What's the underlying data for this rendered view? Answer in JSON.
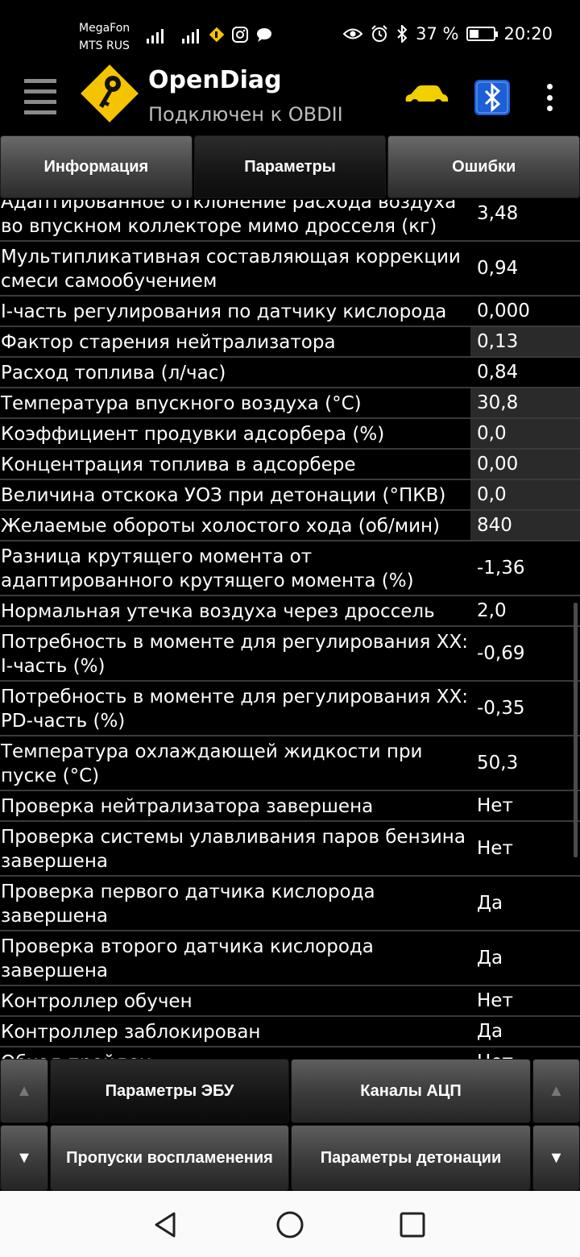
{
  "status_bar": {
    "carrier1": "MegaFon",
    "carrier2": "MTS RUS",
    "battery_text": "37 %",
    "battery_level": 0.37,
    "time": "20:20",
    "icons": [
      "signal-icon",
      "h-plus-icon",
      "signal-icon",
      "app-notification-icon",
      "instagram-icon",
      "chat-icon",
      "eye-icon",
      "alarm-icon",
      "bluetooth-icon",
      "battery-icon"
    ]
  },
  "app_bar": {
    "title": "OpenDiag",
    "subtitle": "Подключен к OBDII"
  },
  "tabs": [
    {
      "label": "Информация",
      "active": false
    },
    {
      "label": "Параметры",
      "active": true
    },
    {
      "label": "Ошибки",
      "active": false
    }
  ],
  "params": {
    "rows": [
      {
        "name": "Адаптированное отклонение расхода воздуха во впускном коллекторе мимо дросселя (кг)",
        "value": "3,48"
      },
      {
        "name": "Мультипликативная составляющая коррекции смеси самообучением",
        "value": "0,94"
      },
      {
        "name": "I-часть регулирования по датчику кислорода",
        "value": "0,000"
      },
      {
        "name": "Фактор старения нейтрализатора",
        "value": "0,13",
        "highlight": true
      },
      {
        "name": "Расход топлива (л/час)",
        "value": "0,84"
      },
      {
        "name": "Температура впускного воздуха (°C)",
        "value": "30,8",
        "highlight": true
      },
      {
        "name": "Коэффициент продувки адсорбера (%)",
        "value": "0,0",
        "highlight": true
      },
      {
        "name": "Концентрация топлива в адсорбере",
        "value": "0,00",
        "highlight": true
      },
      {
        "name": "Величина отскока УОЗ при детонации (°ПКВ)",
        "value": "0,0",
        "highlight": true
      },
      {
        "name": "Желаемые обороты холостого хода (об/мин)",
        "value": "840",
        "highlight": true
      },
      {
        "name": "Разница крутящего момента от адаптированного крутящего момента (%)",
        "value": "-1,36"
      },
      {
        "name": "Нормальная утечка воздуха через дроссель",
        "value": "2,0"
      },
      {
        "name": "Потребность в моменте для регулирования ХХ: I-часть (%)",
        "value": "-0,69"
      },
      {
        "name": "Потребность в моменте для регулирования ХХ: PD-часть (%)",
        "value": "-0,35"
      },
      {
        "name": "Температура охлаждающей жидкости при пуске (°C)",
        "value": "50,3"
      },
      {
        "name": "Проверка нейтрализатора завершена",
        "value": "Нет"
      },
      {
        "name": "Проверка системы улавливания паров бензина завершена",
        "value": "Нет"
      },
      {
        "name": "Проверка первого датчика кислорода завершена",
        "value": "Да"
      },
      {
        "name": "Проверка второго датчика кислорода завершена",
        "value": "Да"
      },
      {
        "name": "Контроллер обучен",
        "value": "Нет"
      },
      {
        "name": "Контроллер заблокирован",
        "value": "Да"
      },
      {
        "name": "Обход пройден",
        "value": "Нет"
      }
    ]
  },
  "bottom_buttons": {
    "up_left": "▲",
    "ecu_params": "Параметры ЭБУ",
    "adc_channels": "Каналы АЦП",
    "up_right": "▲",
    "down_left": "▼",
    "misfires": "Пропуски воспламенения",
    "knock_params": "Параметры детонации",
    "down_right": "▼"
  },
  "nav_bar": {
    "icons": [
      "back-icon",
      "home-icon",
      "recents-icon"
    ]
  },
  "colors": {
    "background": "#000000",
    "row_highlight": "#2a2a2a",
    "divider": "#3a3a3a",
    "logo_yellow": "#f5c400",
    "car_yellow": "#f2d000",
    "bluetooth_blue": "#1c5fd6"
  }
}
